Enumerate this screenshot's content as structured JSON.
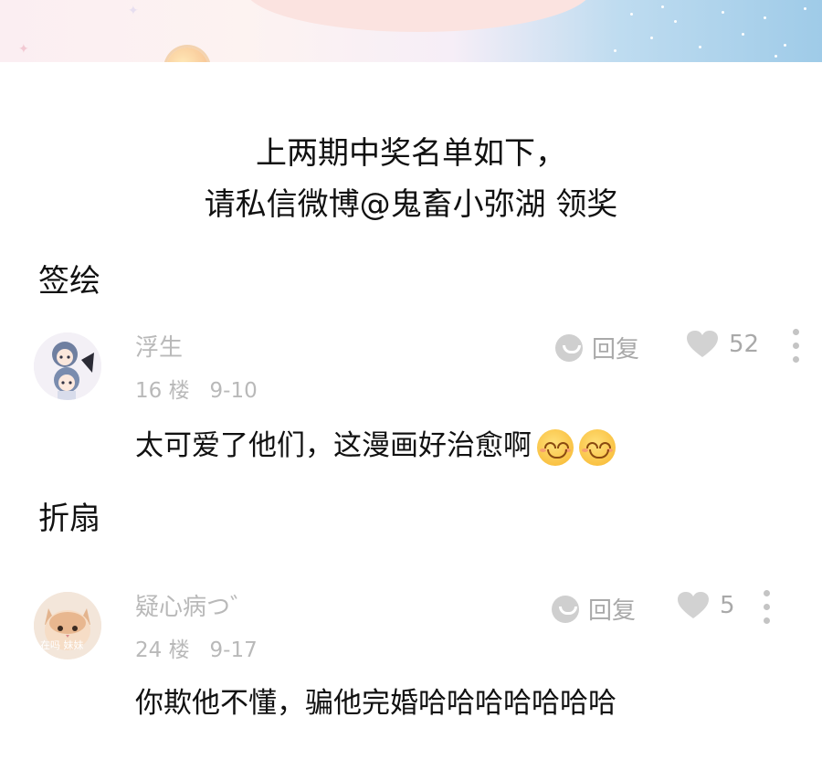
{
  "headline": {
    "line1": "上两期中奖名单如下，",
    "line2": "请私信微博@鬼畜小弥湖 领奖"
  },
  "sections": [
    {
      "label": "签绘",
      "comment": {
        "username": "浮生",
        "floor": "16 楼",
        "date": "9-10",
        "text": "太可爱了他们，这漫画好治愈啊",
        "reply_label": "回复",
        "likes": "52",
        "avatar_icon": "anime-chibi-avatar"
      }
    },
    {
      "label": "折扇",
      "comment": {
        "username": "疑心病つ゛",
        "floor": "24 楼",
        "date": "9-17",
        "text": "你欺他不懂，骗他完婚哈哈哈哈哈哈哈",
        "reply_label": "回复",
        "likes": "5",
        "avatar_icon": "cat-photo-avatar",
        "avatar_caption": "在吗 妹妹"
      }
    }
  ],
  "colors": {
    "meta_gray": "#b9b9b9",
    "text": "#111111",
    "icon_gray": "#cfcfcf"
  }
}
